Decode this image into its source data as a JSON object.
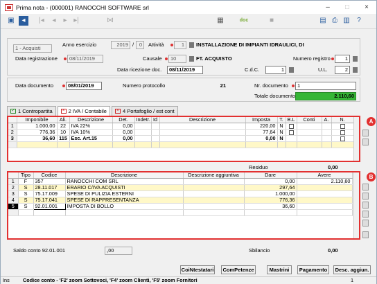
{
  "window": {
    "title": "Prima nota - (000001) RANOCCHI SOFTWARE srl",
    "minimize": "–",
    "maximize": "□",
    "close": "×"
  },
  "toolbar": {
    "doc_label": "doc"
  },
  "header": {
    "causale_type": "1 - Acquisti",
    "anno_esercizio_label": "Anno esercizio",
    "anno_esercizio": "2019",
    "anno_sep": "0",
    "attivita_label": "Attività",
    "attivita_code": "1",
    "attivita_desc": "INSTALLAZIONE DI IMPIANTI IDRAULICI, DI",
    "data_registrazione_label": "Data registrazione",
    "data_registrazione": "08/11/2019",
    "causale_label": "Causale",
    "causale_code": "10",
    "causale_desc": "FT. ACQUISTO",
    "numero_registro_label": "Numero registro",
    "numero_registro": "1",
    "data_ricezione_label": "Data ricezione doc.",
    "data_ricezione": "08/11/2019",
    "cdc_label": "C.d.C.",
    "cdc": "1",
    "ul_label": "U.L.",
    "ul": "2"
  },
  "document": {
    "data_documento_label": "Data documento",
    "data_documento": "08/01/2019",
    "numero_protocollo_label": "Numero protocollo",
    "numero_protocollo": "21",
    "nr_documento_label": "Nr. documento",
    "nr_documento": "1",
    "totale_label": "Totale documento",
    "totale": "2.110,60"
  },
  "tabs": [
    {
      "label": "1 Contropartita"
    },
    {
      "label": "2 IVA / Contabile"
    },
    {
      "label": "4 Portafoglio / est cont"
    }
  ],
  "iva_table": {
    "headers": [
      "Imponibile",
      "Ali.",
      "Descrizione",
      "Det.",
      "Indetr.",
      "Id",
      "Descrizione",
      "Imposta",
      "T.",
      "B.L",
      "Conti",
      "A.",
      "N."
    ],
    "rows": [
      {
        "n": "1",
        "imponibile": "1.000,00",
        "ali": "22",
        "desc": "IVA 22%",
        "det": "0,00",
        "imposta": "220,00",
        "t": "N"
      },
      {
        "n": "2",
        "imponibile": "776,36",
        "ali": "10",
        "desc": "IVA 10%",
        "det": "0,00",
        "imposta": "77,64",
        "t": "N"
      },
      {
        "n": "3",
        "imponibile": "36,60",
        "ali": "115",
        "desc": "Esc. Art.15",
        "det": "0,00",
        "imposta": "0,00",
        "t": "N"
      }
    ],
    "residuo_label": "Residuo",
    "residuo": "0,00"
  },
  "conti_table": {
    "headers": [
      "Tipo",
      "Codice",
      "Descrizione",
      "Descrizione aggiuntiva",
      "Dare",
      "Avere"
    ],
    "rows": [
      {
        "n": "1",
        "tipo": "F",
        "codice": "357",
        "desc": "RANOCCHI COM SRL",
        "agg": "",
        "dare": "0,00",
        "avere": "2.110,60"
      },
      {
        "n": "2",
        "tipo": "S",
        "codice": "28.11.017",
        "desc": "ERARIO C/IVA ACQUISTI",
        "agg": "",
        "dare": "297,64",
        "avere": "0,00"
      },
      {
        "n": "3",
        "tipo": "S",
        "codice": "75.17.009",
        "desc": "SPESE DI PULIZIA ESTERNI",
        "agg": "",
        "dare": "1.000,00",
        "avere": "0,00"
      },
      {
        "n": "4",
        "tipo": "S",
        "codice": "75.17.041",
        "desc": "SPESE DI RAPPRESENTANZA",
        "agg": "",
        "dare": "776,36",
        "avere": "0,00"
      },
      {
        "n": "5",
        "tipo": "S",
        "codice": "92.01.001",
        "desc": "IMPOSTA DI BOLLO",
        "agg": "",
        "dare": "36,60",
        "avere": "0,00"
      }
    ],
    "saldo_label": "Saldo conto 92.01.001",
    "saldo": ",00",
    "sbilancio_label": "Sbilancio",
    "sbilancio": "0,00"
  },
  "buttons": [
    "CoiNtestatari",
    "ComPetenze",
    "Mastrini",
    "Pagamento",
    "Desc. aggiun."
  ],
  "badges": {
    "a": "A",
    "b": "B"
  },
  "status": {
    "mode": "Ins",
    "hint": "Codice conto - 'F2' zoom Sottovoci, 'F4' zoom Clienti, 'F5' zoom Fornitori",
    "page": "1"
  },
  "colors": {
    "accent_red": "#e23030",
    "total_green": "#35b535",
    "row_highlight": "#fff8c8"
  }
}
